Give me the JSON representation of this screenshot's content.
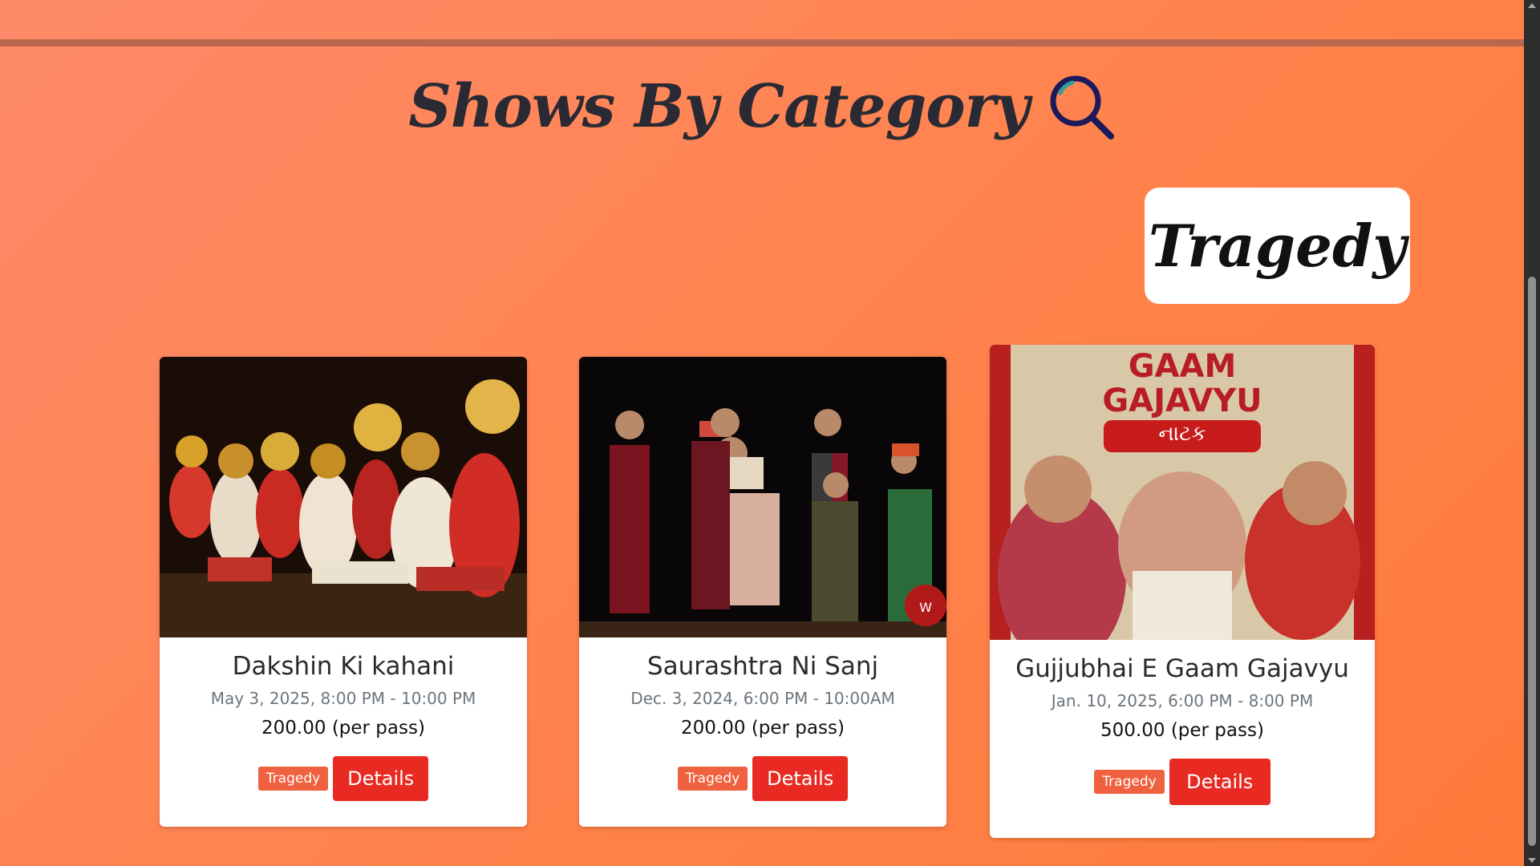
{
  "page": {
    "heading": "Shows By Category",
    "category_label": "Tragedy"
  },
  "colors": {
    "badge": "#f0623f",
    "details_button": "#e82a22",
    "background_start": "#ff8a6a",
    "background_end": "#ff7a3a"
  },
  "shows": [
    {
      "title": "Dakshin Ki kahani",
      "datetime": "May 3, 2025, 8:00 PM - 10:00 PM",
      "price": "200.00 (per pass)",
      "badge": "Tragedy",
      "button": "Details"
    },
    {
      "title": "Saurashtra Ni Sanj",
      "datetime": "Dec. 3, 2024, 6:00 PM - 10:00AM",
      "price": "200.00 (per pass)",
      "badge": "Tragedy",
      "button": "Details"
    },
    {
      "title": "Gujjubhai E Gaam Gajavyu",
      "datetime": "Jan. 10, 2025, 6:00 PM - 8:00 PM",
      "price": "500.00 (per pass)",
      "badge": "Tragedy",
      "button": "Details",
      "poster_text": {
        "line1": "GAAM",
        "line2": "GAJAVYU",
        "tag": "નાટક"
      }
    }
  ]
}
